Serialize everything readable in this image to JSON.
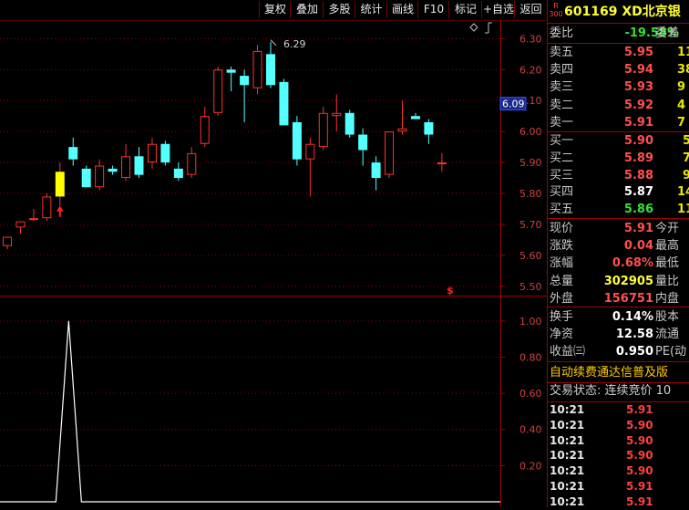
{
  "toolbar": {
    "buttons": [
      "复权",
      "叠加",
      "多股",
      "统计",
      "画线",
      "F10",
      "标记",
      "+自选",
      "返回"
    ]
  },
  "chart_data": {
    "type": "candlestick",
    "price_axis": {
      "ticks": [
        "6.30",
        "6.20",
        "6.10",
        "6.00",
        "5.90",
        "5.80",
        "5.70",
        "5.60",
        "5.50"
      ],
      "ylim": [
        5.47,
        6.36
      ]
    },
    "current_price_tag": "6.09",
    "high_label": "6.29",
    "indicator_axis": {
      "ticks": [
        "1.00",
        "0.80",
        "0.60",
        "0.40",
        "0.20"
      ],
      "ylim": [
        0,
        1.08
      ]
    },
    "candles": [
      {
        "o": 5.63,
        "h": 5.66,
        "l": 5.62,
        "c": 5.66
      },
      {
        "o": 5.69,
        "h": 5.71,
        "l": 5.67,
        "c": 5.71
      },
      {
        "o": 5.72,
        "h": 5.75,
        "l": 5.71,
        "c": 5.72
      },
      {
        "o": 5.72,
        "h": 5.8,
        "l": 5.71,
        "c": 5.79
      },
      {
        "o": 5.79,
        "h": 5.9,
        "l": 5.76,
        "c": 5.87
      },
      {
        "o": 5.95,
        "h": 5.98,
        "l": 5.89,
        "c": 5.91
      },
      {
        "o": 5.88,
        "h": 5.89,
        "l": 5.82,
        "c": 5.82
      },
      {
        "o": 5.82,
        "h": 5.91,
        "l": 5.81,
        "c": 5.89
      },
      {
        "o": 5.88,
        "h": 5.89,
        "l": 5.86,
        "c": 5.87
      },
      {
        "o": 5.85,
        "h": 5.96,
        "l": 5.84,
        "c": 5.92
      },
      {
        "o": 5.92,
        "h": 5.95,
        "l": 5.85,
        "c": 5.86
      },
      {
        "o": 5.9,
        "h": 5.98,
        "l": 5.88,
        "c": 5.96
      },
      {
        "o": 5.96,
        "h": 5.97,
        "l": 5.89,
        "c": 5.9
      },
      {
        "o": 5.88,
        "h": 5.9,
        "l": 5.84,
        "c": 5.85
      },
      {
        "o": 5.86,
        "h": 5.95,
        "l": 5.85,
        "c": 5.93
      },
      {
        "o": 5.96,
        "h": 6.08,
        "l": 5.95,
        "c": 6.05
      },
      {
        "o": 6.06,
        "h": 6.21,
        "l": 6.05,
        "c": 6.2
      },
      {
        "o": 6.2,
        "h": 6.21,
        "l": 6.13,
        "c": 6.19
      },
      {
        "o": 6.18,
        "h": 6.2,
        "l": 6.03,
        "c": 6.15
      },
      {
        "o": 6.14,
        "h": 6.28,
        "l": 6.12,
        "c": 6.26
      },
      {
        "o": 6.25,
        "h": 6.29,
        "l": 6.14,
        "c": 6.15
      },
      {
        "o": 6.16,
        "h": 6.17,
        "l": 6.02,
        "c": 6.02
      },
      {
        "o": 6.03,
        "h": 6.05,
        "l": 5.89,
        "c": 5.91
      },
      {
        "o": 5.91,
        "h": 5.98,
        "l": 5.79,
        "c": 5.96
      },
      {
        "o": 5.95,
        "h": 6.08,
        "l": 5.94,
        "c": 6.06
      },
      {
        "o": 6.05,
        "h": 6.12,
        "l": 6.0,
        "c": 6.06
      },
      {
        "o": 6.06,
        "h": 6.07,
        "l": 5.98,
        "c": 5.99
      },
      {
        "o": 5.99,
        "h": 6.01,
        "l": 5.89,
        "c": 5.94
      },
      {
        "o": 5.9,
        "h": 5.92,
        "l": 5.81,
        "c": 5.85
      },
      {
        "o": 5.86,
        "h": 6.0,
        "l": 5.85,
        "c": 6.0
      },
      {
        "o": 6.0,
        "h": 6.1,
        "l": 5.99,
        "c": 6.01
      },
      {
        "o": 6.05,
        "h": 6.06,
        "l": 6.04,
        "c": 6.04
      },
      {
        "o": 6.03,
        "h": 6.04,
        "l": 5.96,
        "c": 5.99
      },
      {
        "o": 5.9,
        "h": 5.93,
        "l": 5.87,
        "c": 5.9
      }
    ],
    "highlight_candle": 4,
    "indicator_line": {
      "peak_index": 3,
      "peak_value": 1.0
    }
  },
  "quote": {
    "market_badge": "R\n300",
    "code_name": "601169 XD北京银",
    "weibi": {
      "label": "委比",
      "value": "-19.58%",
      "label2": "委差"
    },
    "sell": [
      {
        "label": "卖五",
        "price": "5.95",
        "vol": "11"
      },
      {
        "label": "卖四",
        "price": "5.94",
        "vol": "38"
      },
      {
        "label": "卖三",
        "price": "5.93",
        "vol": "9"
      },
      {
        "label": "卖二",
        "price": "5.92",
        "vol": "4"
      },
      {
        "label": "卖一",
        "price": "5.91",
        "vol": "7"
      }
    ],
    "buy": [
      {
        "label": "买一",
        "price": "5.90",
        "vol": "5"
      },
      {
        "label": "买二",
        "price": "5.89",
        "vol": "7"
      },
      {
        "label": "买三",
        "price": "5.88",
        "vol": "9"
      },
      {
        "label": "买四",
        "price": "5.87",
        "vol": "14"
      },
      {
        "label": "买五",
        "price": "5.86",
        "vol": "11"
      }
    ],
    "stats": [
      {
        "label": "现价",
        "value": "5.91",
        "label2": "今开",
        "color": "red"
      },
      {
        "label": "涨跌",
        "value": "0.04",
        "label2": "最高",
        "color": "red"
      },
      {
        "label": "涨幅",
        "value": "0.68%",
        "label2": "最低",
        "color": "red"
      },
      {
        "label": "总量",
        "value": "302905",
        "label2": "量比",
        "color": "yellow"
      },
      {
        "label": "外盘",
        "value": "156751",
        "label2": "内盘",
        "color": "red"
      }
    ],
    "fund": [
      {
        "label": "换手",
        "value": "0.14%",
        "label2": "股本"
      },
      {
        "label": "净资",
        "value": "12.58",
        "label2": "流通"
      },
      {
        "label": "收益㈢",
        "value": "0.950",
        "label2": "PE(动"
      }
    ],
    "notice": "自动续费通达信普及版",
    "trade_status": "交易状态: 连续竞价 10",
    "ticks": [
      {
        "time": "10:21",
        "price": "5.91"
      },
      {
        "time": "10:21",
        "price": "5.90"
      },
      {
        "time": "10:21",
        "price": "5.90"
      },
      {
        "time": "10:21",
        "price": "5.90"
      },
      {
        "time": "10:21",
        "price": "5.90"
      },
      {
        "time": "10:21",
        "price": "5.91"
      },
      {
        "time": "10:21",
        "price": "5.91"
      }
    ]
  }
}
